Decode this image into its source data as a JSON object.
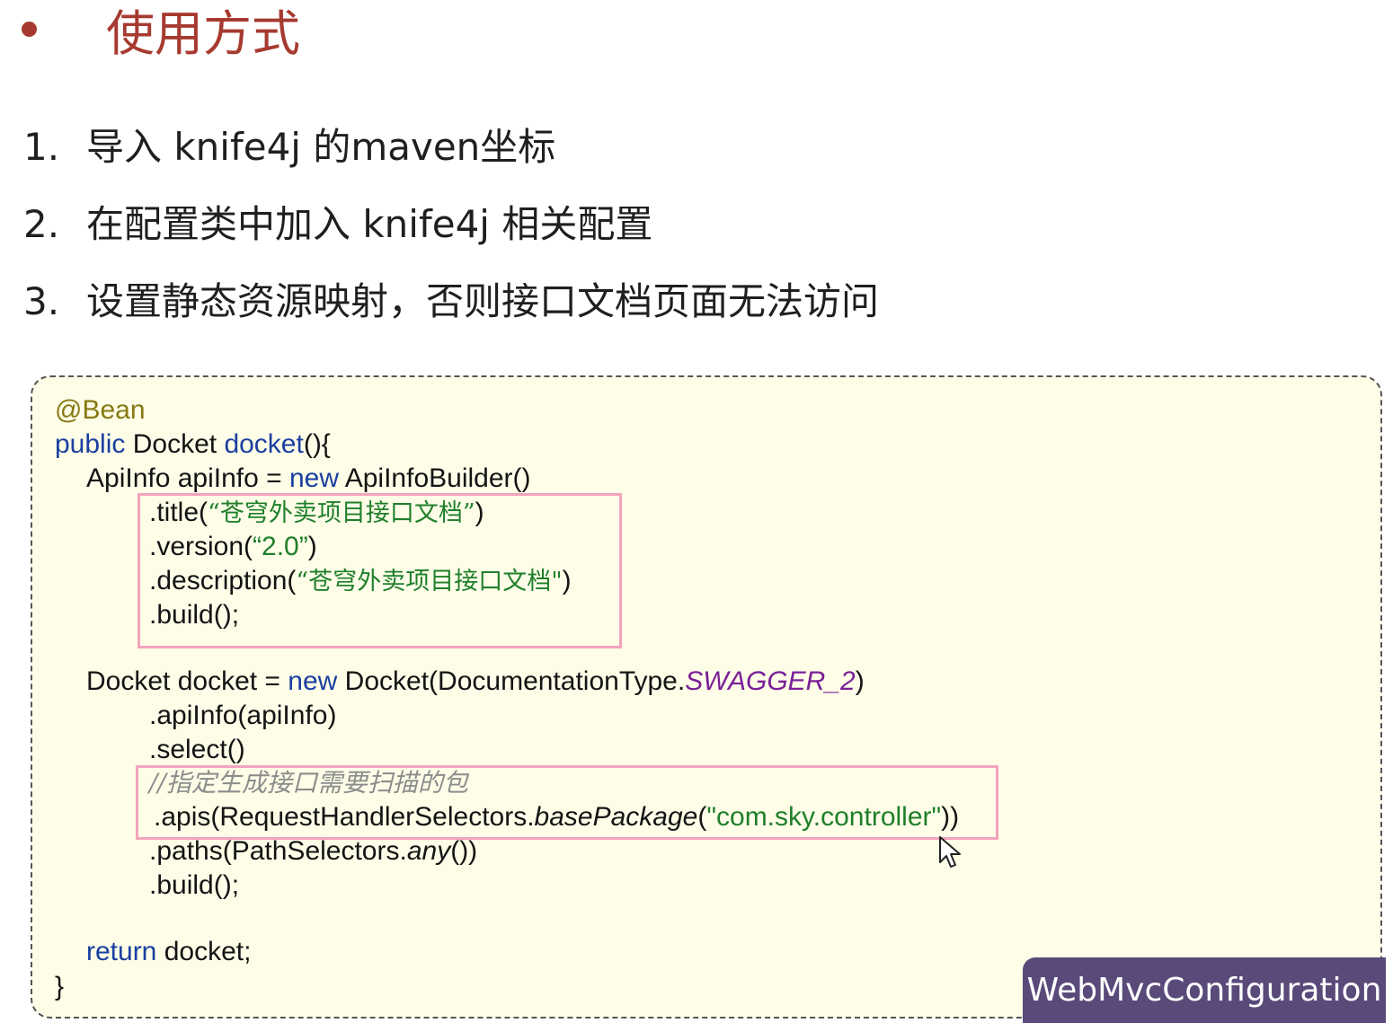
{
  "slide": {
    "heading": "使用方式",
    "steps": [
      {
        "num": "1.",
        "text": "导入 knife4j 的maven坐标"
      },
      {
        "num": "2.",
        "text": "在配置类中加入 knife4j 相关配置"
      },
      {
        "num": "3.",
        "text": "设置静态资源映射，否则接口文档页面无法访问"
      }
    ]
  },
  "code": {
    "l1": {
      "annotation": "@Bean"
    },
    "l2": {
      "kw": "public",
      "type": " Docket ",
      "method": "docket",
      "rest": "(){"
    },
    "l3": {
      "pre": "ApiInfo apiInfo = ",
      "kw": "new",
      "post": " ApiInfoBuilder()"
    },
    "l4": {
      "pre": ".title(",
      "str": "“苍穹外卖项目接口文档”",
      "post": ")"
    },
    "l5": {
      "pre": ".version(",
      "str": "“2.0”",
      "post": ")"
    },
    "l6": {
      "pre": ".description(",
      "str": "“苍穹外卖项目接口文档\"",
      "post": ")"
    },
    "l7": {
      "text": ".build();"
    },
    "l8": {
      "pre": "Docket docket = ",
      "kw": "new",
      "mid": " Docket(DocumentationType.",
      "const": "SWAGGER_2",
      "post": ")"
    },
    "l9": {
      "text": ".apiInfo(apiInfo)"
    },
    "l10": {
      "text": ".select()"
    },
    "l11": {
      "comment": "//指定生成接口需要扫描的包"
    },
    "l12": {
      "pre": ".apis(RequestHandlerSelectors.",
      "ital": "basePackage",
      "open": "(",
      "str": "\"com.sky.controller\"",
      "post": "))"
    },
    "l13": {
      "pre": ".paths(PathSelectors.",
      "ital": "any",
      "post": "())"
    },
    "l14": {
      "text": ".build();"
    },
    "l15": {
      "kw": "return",
      "post": " docket;"
    },
    "l16": {
      "text": "}"
    }
  },
  "badge": {
    "label": "WebMvcConfiguration"
  },
  "colors": {
    "heading": "#a63a30",
    "code_background": "#fdfde8",
    "highlight_border": "#f2a4bc",
    "keyword": "#1b3fa0",
    "string": "#1f7f2a",
    "annotation": "#867a12",
    "constant": "#7a1f97",
    "badge_background": "#5a4a7a"
  },
  "icons": {
    "cursor": "mouse-pointer-icon",
    "bullet": "bullet-dot-icon"
  }
}
